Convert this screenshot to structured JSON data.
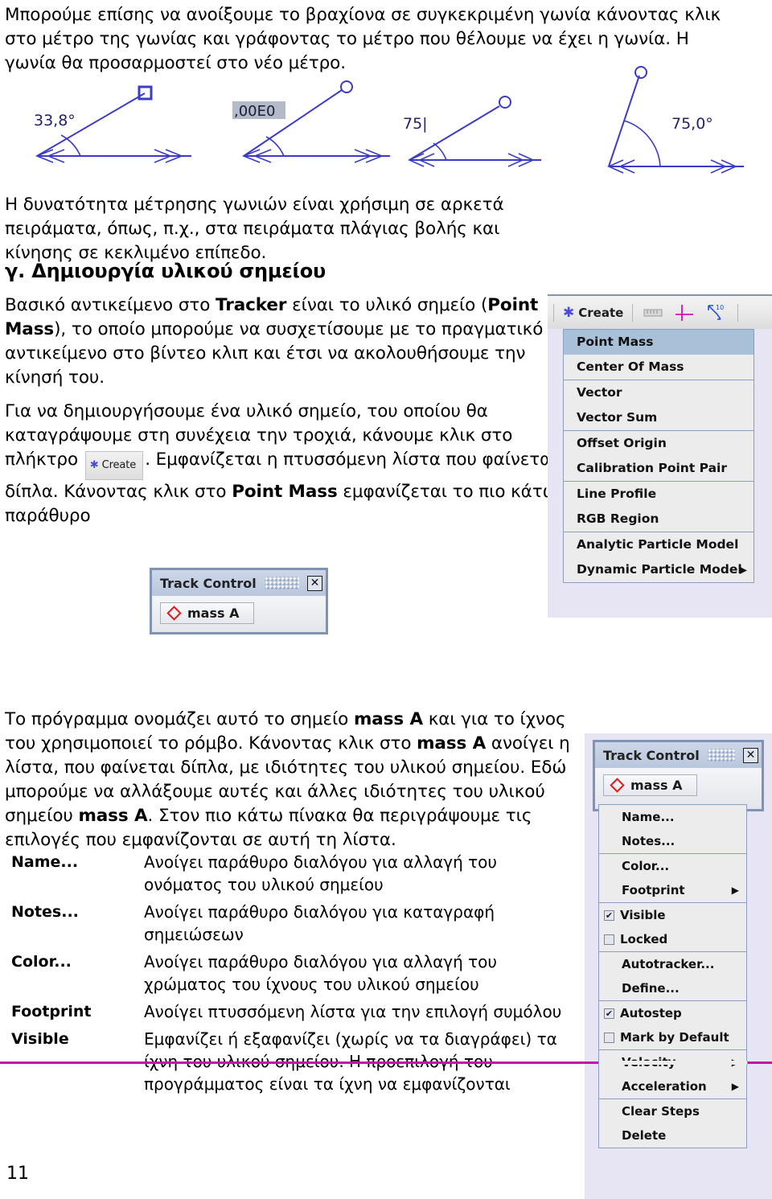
{
  "document": {
    "page_number": "11",
    "intro_paragraph": "Μπορούμε επίσης να ανοίξουμε το βραχίονα σε συγκεκριμένη γωνία κάνοντας κλικ στο μέτρο της γωνίας και γράφοντας το μέτρο που θέλουμε να έχει η γωνία. Η γωνία θα προσαρμοστεί στο νέο μέτρο.",
    "angles_use_paragraph": "Η δυνατότητα μέτρησης γωνιών είναι χρήσιμη σε αρκετά πειράματα, όπως, π.χ., στα πειράματα πλάγιας βολής και κίνησης σε κεκλιμένο επίπεδο.",
    "section_heading": "γ. Δημιουργία υλικού σημείου",
    "pointmass_paragraph_parts": {
      "p1": "Βασικό αντικείμενο στο ",
      "b1": "Tracker",
      "p2": " είναι το υλικό σημείο (",
      "b2": "Point Mass",
      "p3": "), το οποίο μπορούμε να συσχετίσουμε με το πραγματικό αντικείμενο στο βίντεο κλιπ και έτσι να ακολουθήσουμε την κίνησή του."
    },
    "create_paragraph_parts": {
      "p1": " Για να δημιουργήσουμε ένα υλικό σημείο, του οποίου θα καταγράψουμε στη συνέχεια την τροχιά, κάνουμε κλικ στο πλήκτρο ",
      "p2": ". Εμφανίζεται η πτυσσόμενη λίστα που φαίνεται δίπλα. Κάνοντας κλικ στο ",
      "b1": "Point Mass",
      "p3": " εμφανίζεται το πιο κάτω παράθυρο"
    },
    "mass_a_paragraph_parts": {
      "p1": "Το πρόγραμμα ονομάζει αυτό το σημείο ",
      "b1": "mass A",
      "p2": " και για το  ίχνος του χρησιμοποιεί το ρόμβο. Κάνοντας κλικ στο ",
      "b2": "mass A",
      "p3": " ανοίγει η λίστα, που φαίνεται δίπλα, με ιδιότητες του υλικού σημείου. Εδώ μπορούμε να αλλάξουμε αυτές και άλλες ιδιότητες του υλικού σημείου ",
      "b3": "mass A",
      "p4": ". Στον πιο κάτω πίνακα θα περιγράψουμε τις επιλογές που εμφανίζονται σε αυτή τη λίστα."
    }
  },
  "angle_figures": [
    {
      "label": "33,8°",
      "handle": "square",
      "editing": false
    },
    {
      "label": ",00E0",
      "handle": "circle",
      "editing": true
    },
    {
      "label": "75|",
      "handle": "circle",
      "editing": true
    },
    {
      "label": "75,0°",
      "handle": "circle",
      "editing": false
    }
  ],
  "create_toolbar": {
    "create_label": "Create",
    "star_icon": "asterisk-icon",
    "tape_icon": "tape-measure-icon",
    "axes_icon": "coordinate-axes-icon",
    "protractor_icon": "protractor-icon"
  },
  "create_menu": {
    "selected": "Point Mass",
    "groups": [
      [
        "Point Mass",
        "Center Of Mass"
      ],
      [
        "Vector",
        "Vector Sum"
      ],
      [
        "Offset Origin",
        "Calibration Point Pair"
      ],
      [
        "Line Profile",
        "RGB Region"
      ],
      [
        "Analytic Particle Model",
        "Dynamic Particle Model"
      ]
    ],
    "submenu_items": [
      "Dynamic Particle Model"
    ],
    "arrow_glyph": "▶"
  },
  "track_control": {
    "title": "Track Control",
    "close_label": "✕",
    "track_name": "mass A",
    "diamond_icon": "diamond-icon"
  },
  "track_menu": {
    "groups": [
      [
        {
          "label": "Name...",
          "type": "item"
        },
        {
          "label": "Notes...",
          "type": "item"
        }
      ],
      [
        {
          "label": "Color...",
          "type": "item"
        },
        {
          "label": "Footprint",
          "type": "submenu"
        }
      ],
      [
        {
          "label": "Visible",
          "type": "checkbox",
          "checked": true
        },
        {
          "label": "Locked",
          "type": "checkbox",
          "checked": false
        }
      ],
      [
        {
          "label": "Autotracker...",
          "type": "item"
        },
        {
          "label": "Define...",
          "type": "item"
        }
      ],
      [
        {
          "label": "Autostep",
          "type": "checkbox",
          "checked": true
        },
        {
          "label": "Mark by Default",
          "type": "checkbox",
          "checked": false
        }
      ],
      [
        {
          "label": "Velocity",
          "type": "submenu"
        },
        {
          "label": "Acceleration",
          "type": "submenu"
        }
      ],
      [
        {
          "label": "Clear Steps",
          "type": "item"
        },
        {
          "label": "Delete",
          "type": "item"
        }
      ]
    ],
    "arrow_glyph": "▶"
  },
  "options_table": {
    "rows": [
      {
        "term": "Name...",
        "description": "Ανοίγει παράθυρο διαλόγου για αλλαγή του ονόματος του υλικού σημείου"
      },
      {
        "term": "Notes...",
        "description": "Ανοίγει παράθυρο διαλόγου για καταγραφή σημειώσεων"
      },
      {
        "term": "Color...",
        "description": "Ανοίγει παράθυρο διαλόγου για αλλαγή του χρώματος του ίχνους του υλικού σημείου"
      },
      {
        "term": "Footprint",
        "description": "Ανοίγει πτυσσόμενη λίστα για την επιλογή συμόλου"
      },
      {
        "term": "Visible",
        "description": "Εμφανίζει ή εξαφανίζει (χωρίς να τα διαγράφει) τα ίχνη του υλικού σημείου. Η προεπιλογή του προγράμματος είναι τα ίχνη να εμφανίζονται"
      }
    ]
  },
  "colors": {
    "angle_blue": "#3b3bc8",
    "menu_selection": "#a8c0d8",
    "app_lavender": "#e7e5f4",
    "diamond_red": "#e01b1b",
    "magenta_rule": "#c511a8",
    "window_border": "#7f93b5"
  }
}
